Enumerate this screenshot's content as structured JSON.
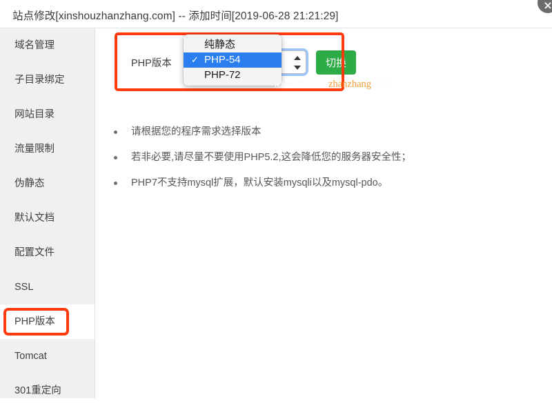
{
  "window": {
    "title": "站点修改[xinshouzhanzhang.com] -- 添加时间[2019-06-28 21:21:29]",
    "close_icon": "close-icon"
  },
  "sidebar": {
    "items": [
      {
        "label": "域名管理",
        "active": false
      },
      {
        "label": "子目录绑定",
        "active": false
      },
      {
        "label": "网站目录",
        "active": false
      },
      {
        "label": "流量限制",
        "active": false
      },
      {
        "label": "伪静态",
        "active": false
      },
      {
        "label": "默认文档",
        "active": false
      },
      {
        "label": "配置文件",
        "active": false
      },
      {
        "label": "SSL",
        "active": false
      },
      {
        "label": "PHP版本",
        "active": true
      },
      {
        "label": "Tomcat",
        "active": false
      },
      {
        "label": "301重定向",
        "active": false
      }
    ]
  },
  "main": {
    "php_version": {
      "label": "PHP版本",
      "selected_value": "PHP-54",
      "options": [
        {
          "label": "纯静态",
          "selected": false
        },
        {
          "label": "PHP-54",
          "selected": true
        },
        {
          "label": "PHP-72",
          "selected": false
        }
      ],
      "switch_button": "切换",
      "stepper_up_icon": "chevron-up-icon",
      "stepper_down_icon": "chevron-down-icon",
      "check_icon": "✓"
    },
    "watermark": {
      "prefix": "www.xinshou",
      "accent": "zhanzhang",
      "suffix": ".com"
    },
    "notes": [
      "请根据您的程序需求选择版本",
      "若非必要,请尽量不要使用PHP5.2,这会降低您的服务器安全性；",
      "PHP7不支持mysql扩展，默认安装mysqli以及mysql-pdo。"
    ]
  },
  "colors": {
    "highlight_red": "#ff3b0d",
    "switch_green": "#2cab46",
    "select_blue": "#2a7ef0",
    "sidebar_bg": "#eff0f2",
    "watermark_accent": "#f5a33c"
  }
}
